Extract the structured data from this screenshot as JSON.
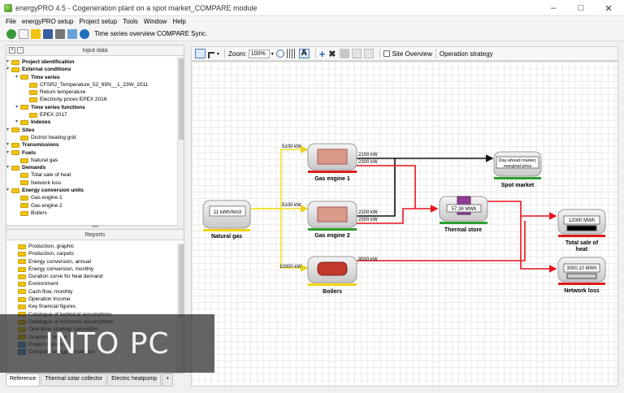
{
  "window": {
    "app_title": "energyPRO 4.5",
    "separator": "-",
    "doc_title": "Cogeneration plant on a spot market_COMPARE module"
  },
  "menu": [
    "File",
    "energyPRO setup",
    "Project setup",
    "Tools",
    "Window",
    "Help"
  ],
  "toolbar": {
    "compare_label": "Time series overview  COMPARE Sync."
  },
  "input_panel": {
    "title": "Input data",
    "items": [
      {
        "label": "Project identification",
        "bold": true,
        "level": 0
      },
      {
        "label": "External conditions",
        "bold": true,
        "level": 0
      },
      {
        "label": "Time series",
        "bold": true,
        "level": 1
      },
      {
        "label": "CFSR2_Temperature_52_85N__1_23W_2011",
        "bold": false,
        "level": 2
      },
      {
        "label": "Return temperature",
        "bold": false,
        "level": 2
      },
      {
        "label": "Electricity prices EPEX 2016",
        "bold": false,
        "level": 2
      },
      {
        "label": "Time series functions",
        "bold": true,
        "level": 1
      },
      {
        "label": "EPEX 2017",
        "bold": false,
        "level": 2
      },
      {
        "label": "Indexes",
        "bold": true,
        "level": 1
      },
      {
        "label": "Sites",
        "bold": true,
        "level": 0
      },
      {
        "label": "District heating grid",
        "bold": false,
        "level": 1
      },
      {
        "label": "Transmissions",
        "bold": true,
        "level": 0
      },
      {
        "label": "Fuels",
        "bold": true,
        "level": 0
      },
      {
        "label": "Natural gas",
        "bold": false,
        "level": 1
      },
      {
        "label": "Demands",
        "bold": true,
        "level": 0
      },
      {
        "label": "Total sale of heat",
        "bold": false,
        "level": 1
      },
      {
        "label": "Network loss",
        "bold": false,
        "level": 1
      },
      {
        "label": "Energy conversion units",
        "bold": true,
        "level": 0
      },
      {
        "label": "Gas engine 1",
        "bold": false,
        "level": 1
      },
      {
        "label": "Gas engine 2",
        "bold": false,
        "level": 1
      },
      {
        "label": "Boilers",
        "bold": false,
        "level": 1
      }
    ]
  },
  "reports_panel": {
    "title": "Reports",
    "items": [
      {
        "label": "Production, graphic",
        "kind": "folder"
      },
      {
        "label": "Production, carpets",
        "kind": "folder"
      },
      {
        "label": "Energy conversion, annual",
        "kind": "folder"
      },
      {
        "label": "Energy conversion, monthly",
        "kind": "folder"
      },
      {
        "label": "Duration curve for heat demand",
        "kind": "folder"
      },
      {
        "label": "Environment",
        "kind": "folder"
      },
      {
        "label": "Cash flow, monthly",
        "kind": "folder"
      },
      {
        "label": "Operation Income",
        "kind": "folder"
      },
      {
        "label": "Key financial figures",
        "kind": "folder"
      },
      {
        "label": "Catalogue of technical assumptions",
        "kind": "folder"
      },
      {
        "label": "Catalogue of economic assumptions",
        "kind": "folder"
      },
      {
        "label": "Operation strategy calculation",
        "kind": "folder"
      },
      {
        "label": "Graphical layout",
        "kind": "folder"
      },
      {
        "label": "Project reports",
        "kind": "db"
      },
      {
        "label": "Compare energy conversion",
        "kind": "db"
      }
    ]
  },
  "bottom_tabs": [
    "Reference",
    "Thermal solar collector",
    "Electric heatpump",
    "+"
  ],
  "diagram_toolbar": {
    "zoom_label": "Zoom:",
    "zoom_value": "100%",
    "site_overview": "Site Overview",
    "operation_strategy": "Operation strategy"
  },
  "diagram": {
    "natural_gas": {
      "label": "Natural gas",
      "value": "11 kWh/Nm3"
    },
    "gas_engine_1": {
      "label": "Gas engine 1",
      "fuel_in": "5100 kW",
      "el_out": "2100 kW",
      "heat_out": "2300 kW"
    },
    "gas_engine_2": {
      "label": "Gas engine 2",
      "fuel_in": "5100 kW",
      "el_out": "2100 kW",
      "heat_out": "2300 kW"
    },
    "boilers": {
      "label": "Boilers",
      "fuel_in": "10000 kW",
      "heat_out": "9500 kW"
    },
    "spot_market": {
      "label": "Spot market",
      "value_line1": "Day-ahead market,",
      "value_line2": "marginal price"
    },
    "thermal_store": {
      "label": "Thermal store",
      "value": "57,38 MWh"
    },
    "total_sale": {
      "label_line1": "Total sale of",
      "label_line2": "heat",
      "value": "12000 MWh"
    },
    "network_loss": {
      "label": "Network loss",
      "value": "3000,10 MWh"
    }
  },
  "watermark": "INTO PC",
  "colors": {
    "fuel_line": "#f0e020",
    "heat_line": "#e8141c",
    "el_line": "#111111",
    "green_bar": "#2e9e2e",
    "red_bar": "#e01818",
    "yellow_bar": "#f2d40c"
  }
}
